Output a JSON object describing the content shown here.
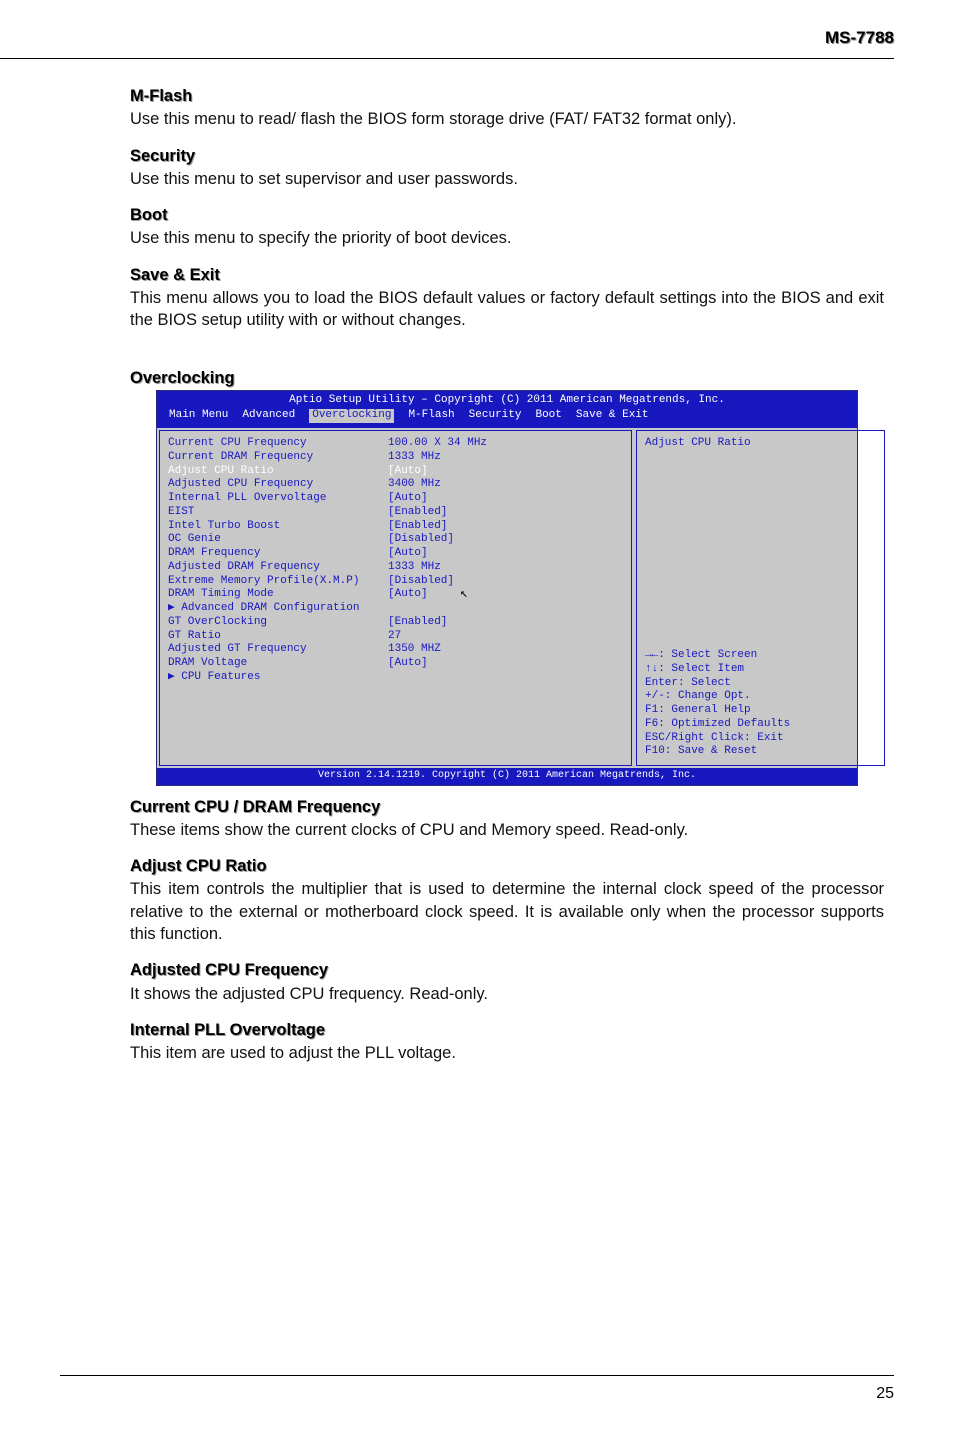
{
  "header": {
    "model": "MS-7788"
  },
  "sections": {
    "mflash": {
      "title": "M-Flash",
      "body": "Use this menu to read/ flash the BIOS form storage drive (FAT/ FAT32 format only)."
    },
    "security": {
      "title": "Security",
      "body": "Use this menu to set supervisor and user passwords."
    },
    "boot": {
      "title": "Boot",
      "body": "Use this menu to specify the priority of boot devices."
    },
    "saveexit": {
      "title": "Save & Exit",
      "body": "This menu allows you to load the BIOS default values or factory default settings into the BIOS and exit the BIOS setup utility with or without changes."
    },
    "overclocking_title": "Overclocking",
    "curfreq": {
      "title": "Current CPU / DRAM Frequency",
      "body": "These items show the current clocks of CPU and Memory speed. Read-only."
    },
    "adjustratio": {
      "title": "Adjust CPU Ratio",
      "body": "This item controls the multiplier that is used to determine the internal clock speed of the processor relative to the external or motherboard clock speed. It is available only when the processor supports this function."
    },
    "adjcpu": {
      "title": "Adjusted CPU Frequency",
      "body": "It shows the adjusted CPU frequency. Read-only."
    },
    "intpll": {
      "title": "Internal PLL Overvoltage",
      "body": "This item are used to adjust the PLL voltage."
    }
  },
  "bios": {
    "title": "Aptio Setup Utility – Copyright (C) 2011 American Megatrends, Inc.",
    "tabs": [
      "Main Menu",
      "Advanced",
      "Overclocking",
      "M-Flash",
      "Security",
      "Boot",
      "Save & Exit"
    ],
    "active_tab": "Overclocking",
    "rows": [
      {
        "label": "Current CPU Frequency",
        "value": "100.00 X 34 MHz"
      },
      {
        "label": "Current DRAM Frequency",
        "value": "1333 MHz"
      },
      {
        "label": "Adjust CPU Ratio",
        "value": "[Auto]",
        "selected": true
      },
      {
        "label": "Adjusted CPU Frequency",
        "value": "3400 MHz"
      },
      {
        "label": "Internal PLL Overvoltage",
        "value": "[Auto]"
      },
      {
        "label": "EIST",
        "value": "[Enabled]"
      },
      {
        "label": "Intel Turbo Boost",
        "value": "[Enabled]"
      },
      {
        "label": "OC Genie",
        "value": "[Disabled]"
      },
      {
        "label": "DRAM Frequency",
        "value": "[Auto]"
      },
      {
        "label": "Adjusted DRAM Frequency",
        "value": "1333 MHz"
      },
      {
        "label": "Extreme Memory Profile(X.M.P)",
        "value": "[Disabled]"
      },
      {
        "label": "DRAM Timing Mode",
        "value": "[Auto]"
      },
      {
        "label": "▶ Advanced DRAM Configuration",
        "value": ""
      },
      {
        "label": "GT OverClocking",
        "value": "[Enabled]"
      },
      {
        "label": "GT Ratio",
        "value": "27"
      },
      {
        "label": "Adjusted GT Frequency",
        "value": "1350 MHZ"
      },
      {
        "label": "DRAM Voltage",
        "value": "[Auto]"
      },
      {
        "label": "▶ CPU Features",
        "value": ""
      }
    ],
    "help_title": "Adjust CPU Ratio",
    "help_keys": [
      "→←: Select Screen",
      "↑↓: Select Item",
      "Enter: Select",
      "+/-: Change Opt.",
      "F1: General Help",
      "F6: Optimized Defaults",
      "ESC/Right Click: Exit",
      "F10: Save & Reset"
    ],
    "footer": "Version 2.14.1219. Copyright (C) 2011 American Megatrends, Inc."
  },
  "pagenum": "25"
}
